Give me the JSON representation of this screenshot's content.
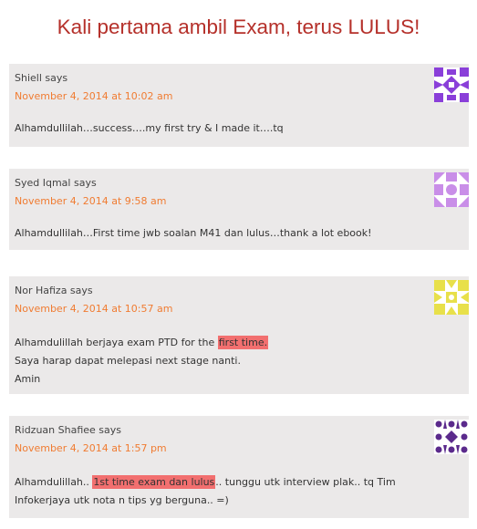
{
  "page": {
    "title": "Kali pertama ambil Exam, terus LULUS!"
  },
  "colors": {
    "title": "#b5302a",
    "date": "#f07c32",
    "card": "#ebe9e9",
    "highlight": "#f26f6f"
  },
  "comments": [
    {
      "author": "Shiell says",
      "date": "November 4, 2014 at 10:02 am",
      "text": "Alhamdullilah…success….my first try & I made it….tq",
      "avatar": {
        "name": "identicon-purple",
        "color": "#8a3fd9"
      }
    },
    {
      "author": "Syed Iqmal says",
      "date": "November 4, 2014 at 9:58 am",
      "text": "Alhamdullilah…First time jwb soalan M41 dan lulus…thank a lot ebook!",
      "avatar": {
        "name": "identicon-lilac",
        "color": "#c98ee8"
      }
    },
    {
      "author": "Nor Hafiza says",
      "date": "November 4, 2014 at 10:57 am",
      "line1_before": "Alhamdulillah berjaya exam PTD for the ",
      "line1_highlight": "first time.",
      "line2": "Saya harap dapat melepasi next stage nanti.",
      "line3": "Amin",
      "avatar": {
        "name": "identicon-yellow",
        "color": "#e8e04a"
      }
    },
    {
      "author": "Ridzuan Shafiee says",
      "date": "November 4, 2014 at 1:57 pm",
      "text_before": "Alhamdulillah.. ",
      "text_highlight": "1st time exam dan lulus",
      "text_after": ".. tunggu utk interview plak.. tq Tim Infokerjaya utk nota n tips yg berguna.. =)",
      "avatar": {
        "name": "identicon-violet",
        "color": "#5b2a8c"
      }
    }
  ]
}
